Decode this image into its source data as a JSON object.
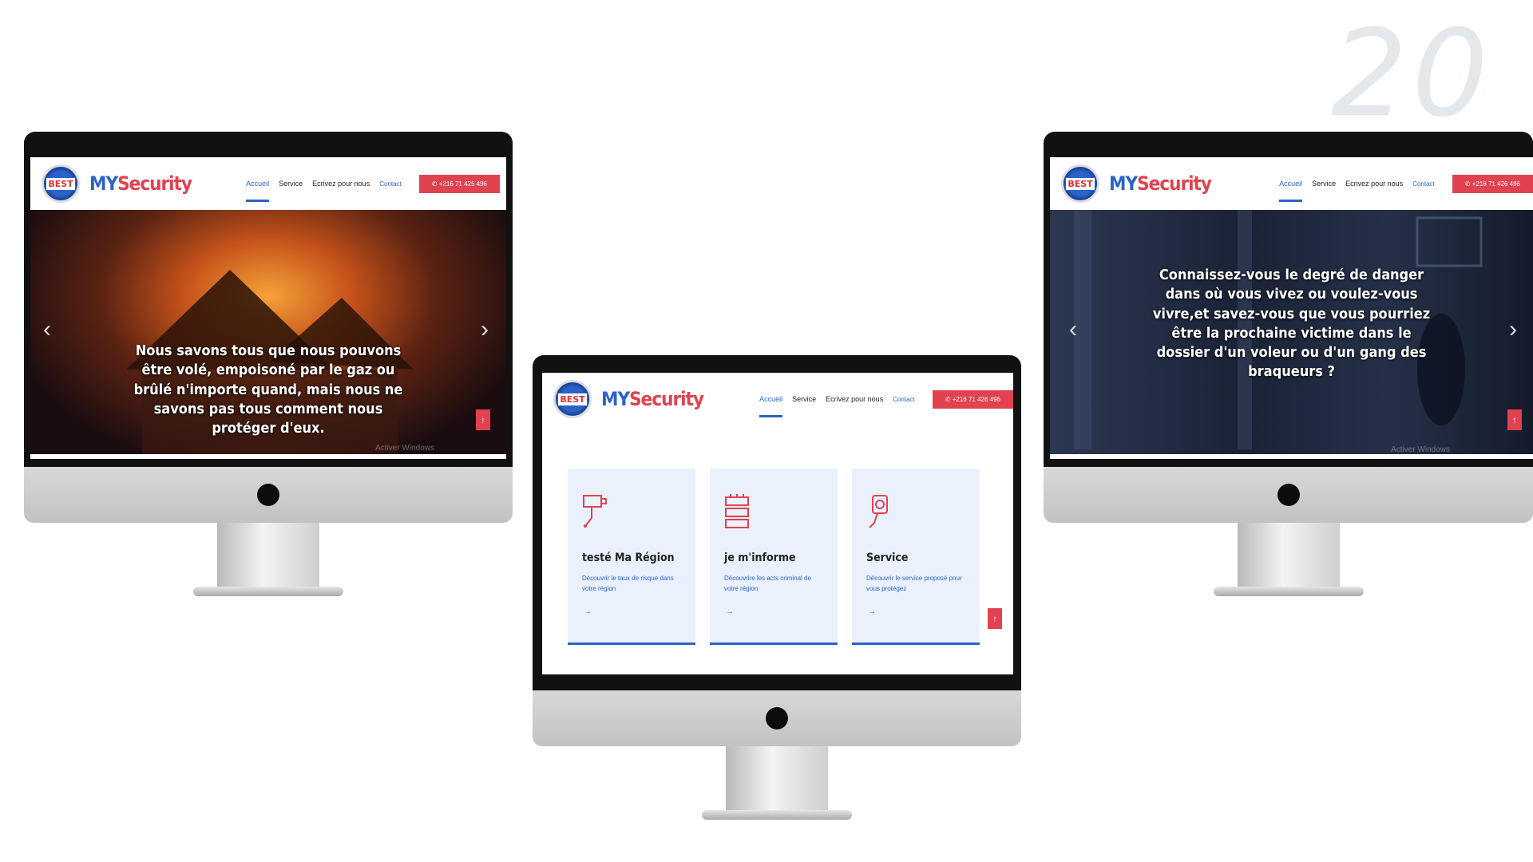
{
  "corner_number": "20",
  "site": {
    "logo_text": "BEST",
    "brand_part1": "MY",
    "brand_part2": "Security",
    "menu": {
      "home": "Accueil",
      "service": "Service",
      "write": "Ecrivez pour nous",
      "contact": "Contact"
    },
    "phone": "+216 71 426 496",
    "scroll_top": "↑",
    "prev_arrow": "‹",
    "next_arrow": "›",
    "activate_windows": "Activer Windows"
  },
  "left_screen": {
    "caption": "Nous savons tous que nous pouvons être volé, empoisoné par le gaz ou brûlé n'importe quand, mais nous ne savons pas tous comment nous protéger d'eux."
  },
  "right_screen": {
    "caption": "Connaissez-vous le degré de danger dans où vous vivez ou voulez-vous vivre,et savez-vous que vous pourriez être la prochaine victime dans le dossier d'un voleur ou d'un gang des braqueurs ?"
  },
  "center_screen": {
    "cards": [
      {
        "icon": "cctv-camera-icon",
        "title": "testé Ma Région",
        "desc": "Découvrir le taux de risque dans votre région",
        "link": "→"
      },
      {
        "icon": "server-rack-icon",
        "title": "je m'informe",
        "desc": "Découvrire les acts criminal de votre région",
        "link": "→"
      },
      {
        "icon": "security-camera-icon",
        "title": "Service",
        "desc": "Découvrir le service proposé pour vous protégez",
        "link": "→"
      }
    ]
  },
  "colors": {
    "brand_blue": "#2c63c9",
    "brand_red": "#e0424f"
  }
}
